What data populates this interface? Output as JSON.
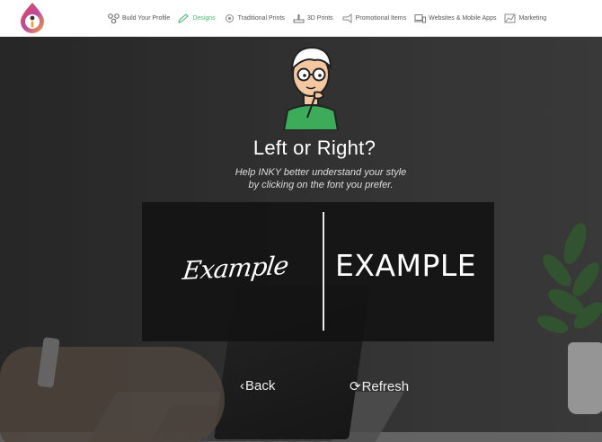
{
  "nav": {
    "items": [
      {
        "label": "Build Your Profile",
        "icon": "profile-icon",
        "active": false
      },
      {
        "label": "Designs",
        "icon": "pencil-icon",
        "active": true
      },
      {
        "label": "Traditional Prints",
        "icon": "print-icon",
        "active": false
      },
      {
        "label": "3D Prints",
        "icon": "3d-printer-icon",
        "active": false
      },
      {
        "label": "Promotional Items",
        "icon": "megaphone-icon",
        "active": false
      },
      {
        "label": "Websites & Mobile Apps",
        "icon": "devices-icon",
        "active": false
      },
      {
        "label": "Marketing",
        "icon": "chart-icon",
        "active": false
      }
    ]
  },
  "main": {
    "title": "Left or Right?",
    "subtitle_line1": "Help INKY better understand your style",
    "subtitle_line2": "by clicking on the font you prefer.",
    "left_option": "Example",
    "right_option": "EXAMPLE",
    "back_label": "Back",
    "refresh_label": "Refresh"
  },
  "colors": {
    "accent": "#4cb577",
    "overlay": "#121212"
  }
}
